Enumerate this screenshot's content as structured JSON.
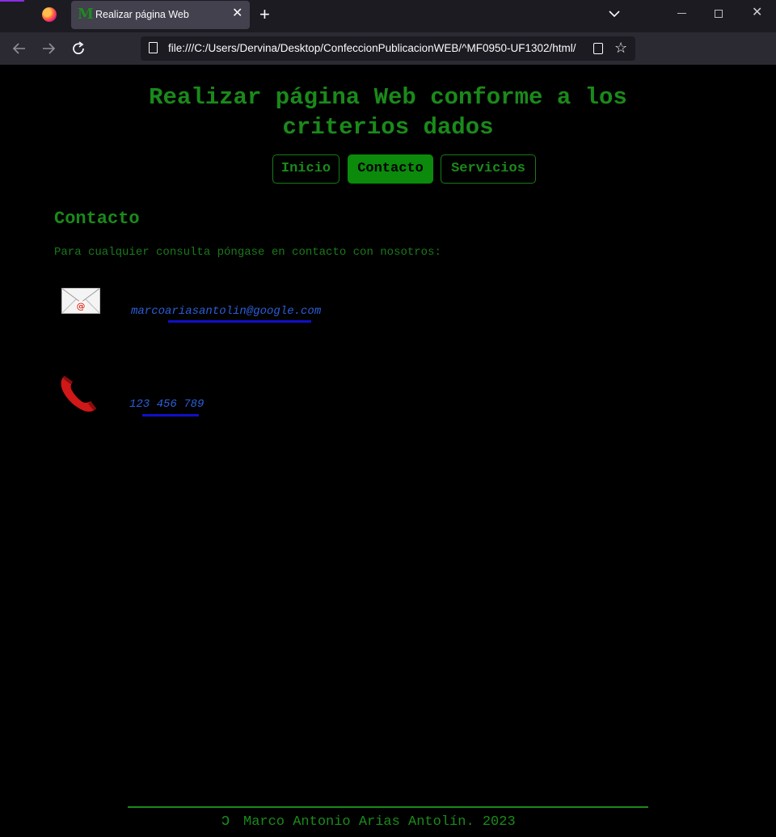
{
  "browser": {
    "tab_title": "Realizar página Web",
    "tab_favicon": "M",
    "url": "file:///C:/Users/Dervina/Desktop/ConfeccionPublicacionWEB/^MF0950-UF1302/html/",
    "icons": [
      "firefox-logo",
      "close-icon",
      "plus-icon",
      "chevron-down-icon",
      "minimize-icon",
      "maximize-icon",
      "window-close-icon",
      "back-icon",
      "forward-icon",
      "reload-icon",
      "page-icon",
      "reader-icon",
      "star-icon",
      "pocket-icon",
      "extensions-icon",
      "menu-icon"
    ]
  },
  "page": {
    "title": "Realizar página Web conforme a los criterios dados",
    "nav": {
      "inicio": "Inicio",
      "contacto": "Contacto",
      "servicios": "Servicios"
    },
    "section_title": "Contacto",
    "intro": "Para cualquier consulta póngase en contacto con nosotros:",
    "email": "marcoariasantolin@google.com",
    "phone": "123 456 789",
    "footer_symbol": "ↄ",
    "footer_text": "Marco Antonio Arias Antolín. 2023"
  },
  "colors": {
    "accent_green": "#1a8a1a",
    "active_button": "#0b8a0b",
    "link_blue": "#2b5fd9",
    "underline_blue": "#1010c8",
    "background": "#000000"
  }
}
